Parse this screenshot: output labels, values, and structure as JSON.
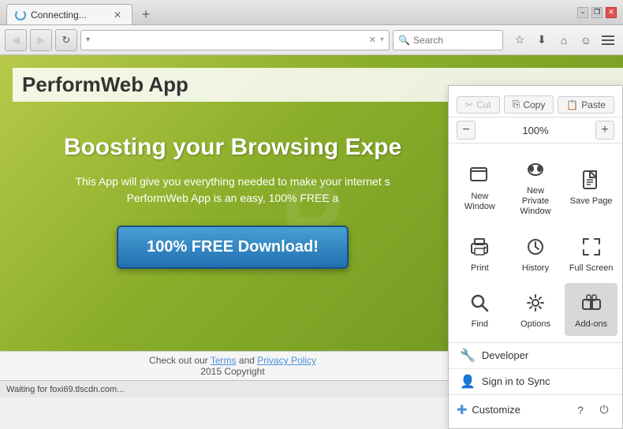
{
  "browser": {
    "tab": {
      "title": "Connecting...",
      "favicon_spinning": true
    },
    "new_tab_label": "+",
    "window_controls": {
      "minimize": "−",
      "restore": "❐",
      "close": "✕"
    }
  },
  "navbar": {
    "back_label": "◀",
    "forward_label": "▶",
    "reload_label": "↻",
    "address_placeholder": "",
    "address_value": "",
    "x_label": "✕",
    "dropdown_label": "▾",
    "search_placeholder": "Search",
    "bookmark_icon": "☆",
    "history_icon": "⬇",
    "home_icon": "⌂",
    "user_icon": "☺",
    "menu_icon": "☰"
  },
  "page": {
    "logo": "PerformWeb App",
    "hero_title": "Boosting your Browsing Expe",
    "hero_desc": "This App will give you everything needed to make your internet s\nPerformWeb App is an easy, 100% FREE a",
    "download_btn": "100% FREE Download!",
    "footer_text": "Check out our",
    "footer_terms": "Terms",
    "footer_and": "and",
    "footer_privacy": "Privacy Policy",
    "footer_copyright": "2015 Copyright"
  },
  "statusbar": {
    "text": "Waiting for foxi69.tlscdn.com..."
  },
  "menu": {
    "cut_label": "Cut",
    "copy_label": "Copy",
    "paste_label": "Paste",
    "zoom_minus": "−",
    "zoom_value": "100%",
    "zoom_plus": "+",
    "items": [
      {
        "id": "new-window",
        "icon": "window",
        "label": "New Window"
      },
      {
        "id": "new-private",
        "icon": "mask",
        "label": "New Private\nWindow"
      },
      {
        "id": "save-page",
        "icon": "save",
        "label": "Save Page"
      },
      {
        "id": "print",
        "icon": "print",
        "label": "Print"
      },
      {
        "id": "history",
        "icon": "history",
        "label": "History"
      },
      {
        "id": "full-screen",
        "icon": "fullscreen",
        "label": "Full Screen"
      },
      {
        "id": "find",
        "icon": "find",
        "label": "Find"
      },
      {
        "id": "options",
        "icon": "options",
        "label": "Options"
      },
      {
        "id": "add-ons",
        "icon": "addons",
        "label": "Add-ons",
        "active": true
      }
    ],
    "developer_label": "Developer",
    "sign_in_label": "Sign in to Sync",
    "customize_label": "Customize",
    "help_icon": "?",
    "power_icon": "⏻"
  }
}
